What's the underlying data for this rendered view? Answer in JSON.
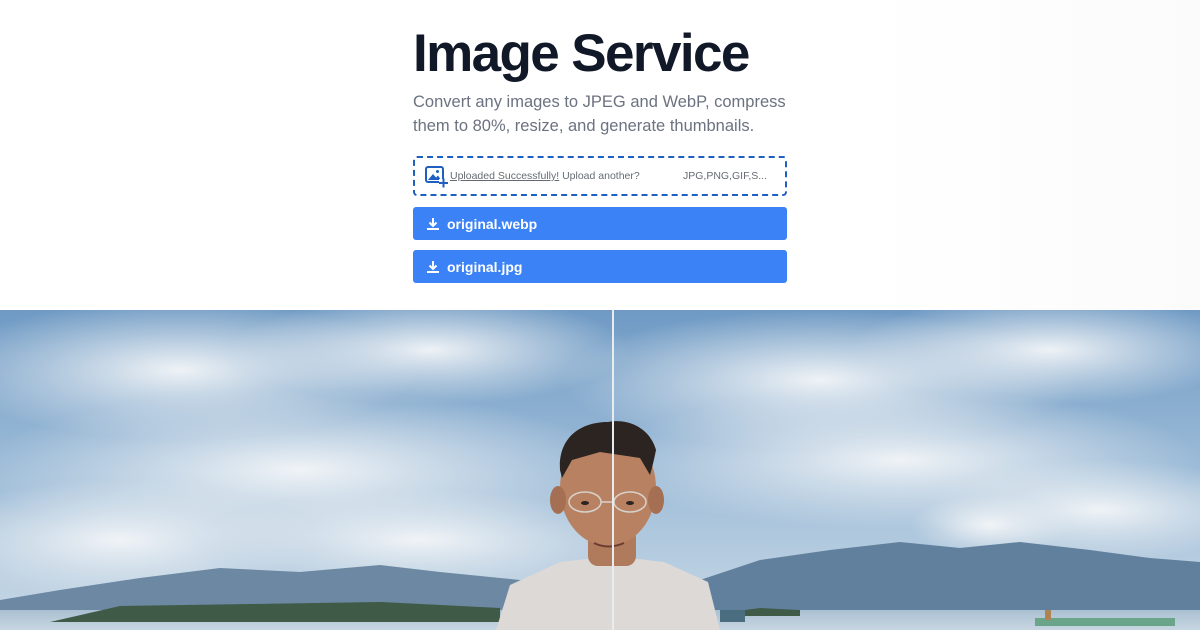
{
  "header": {
    "title": "Image Service",
    "subtitle": "Convert any images to JPEG and WebP, compress them to 80%, resize, and generate thumbnails."
  },
  "uploader": {
    "icon": "image-add-icon",
    "status_link": "Uploaded Successfully!",
    "status_text": " Upload another?",
    "accepted_types": "JPG,PNG,GIF,S..."
  },
  "downloads": [
    {
      "label": "original.webp",
      "icon": "download-icon"
    },
    {
      "label": "original.jpg",
      "icon": "download-icon"
    }
  ],
  "comparison": {
    "divider_position": 0.51
  },
  "colors": {
    "accent": "#3b82f6",
    "dashed_border": "#1e5fbf",
    "title": "#111827",
    "subtitle": "#6b7280"
  }
}
